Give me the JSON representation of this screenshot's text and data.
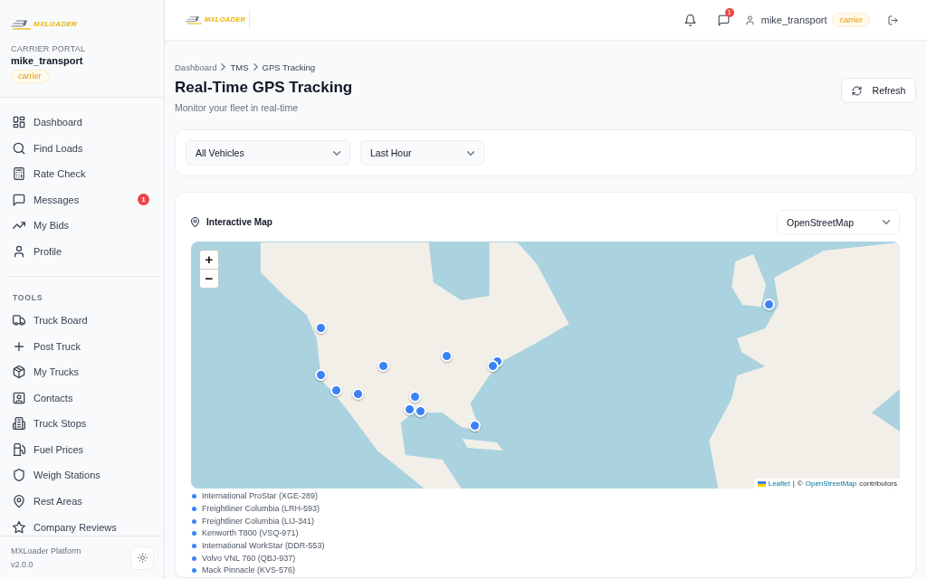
{
  "sidebar": {
    "logo_text": "MXLOADER",
    "portal_label": "CARRIER PORTAL",
    "username": "mike_transport",
    "role_badge": "carrier",
    "nav_items": [
      {
        "label": "Dashboard",
        "selected": false
      },
      {
        "label": "Find Loads",
        "selected": false
      },
      {
        "label": "Rate Check",
        "selected": false
      },
      {
        "label": "Messages",
        "selected": false,
        "badge": "1"
      },
      {
        "label": "My Bids",
        "selected": false
      },
      {
        "label": "Profile",
        "selected": false
      }
    ],
    "tools_heading": "TOOLS",
    "tool_items": [
      {
        "label": "Truck Board",
        "selected": false
      },
      {
        "label": "Post Truck",
        "selected": false
      },
      {
        "label": "My Trucks",
        "selected": false
      },
      {
        "label": "Contacts",
        "selected": false
      },
      {
        "label": "Truck Stops",
        "selected": false
      },
      {
        "label": "Fuel Prices",
        "selected": false
      },
      {
        "label": "Weigh Stations",
        "selected": false
      },
      {
        "label": "Rest Areas",
        "selected": false
      },
      {
        "label": "Company Reviews",
        "selected": false
      }
    ],
    "footer": {
      "platform": "MXLoader Platform",
      "version": "v2.0.0"
    }
  },
  "header": {
    "logo_text": "MXLOADER",
    "messages_badge": "1",
    "username": "mike_transport",
    "role_badge": "carrier"
  },
  "breadcrumb": [
    "Dashboard",
    "TMS",
    "GPS Tracking"
  ],
  "page": {
    "title": "Real-Time GPS Tracking",
    "subtitle": "Monitor your fleet in real-time",
    "refresh_button": "Refresh"
  },
  "filters": [
    {
      "value": "All Vehicles"
    },
    {
      "value": "Last Hour"
    }
  ],
  "map_card": {
    "title": "Interactive Map",
    "layer_select": "OpenStreetMap",
    "zoom_in": "+",
    "zoom_out": "−",
    "attribution": {
      "leaflet": "Leaflet",
      "separator": "|",
      "copyright": "©",
      "osm": "OpenStreetMap",
      "suffix": "contributors"
    },
    "vehicles": [
      "International ProStar (XGE-289)",
      "Freightliner Columbia (LRH-593)",
      "Freightliner Columbia (LIJ-341)",
      "Kenworth T800 (VSQ-971)",
      "International WorkStar (DDR-553)",
      "Volvo VNL 760 (QBJ-937)",
      "Mack Pinnacle (KVS-576)"
    ]
  }
}
